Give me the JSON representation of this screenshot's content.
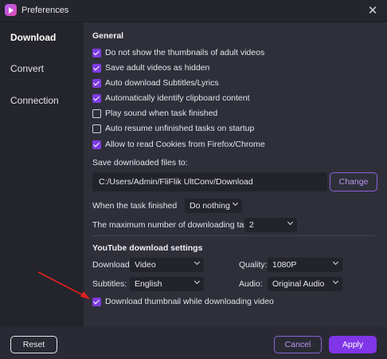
{
  "window": {
    "title": "Preferences"
  },
  "sidebar": {
    "items": [
      {
        "label": "Download",
        "active": true
      },
      {
        "label": "Convert",
        "active": false
      },
      {
        "label": "Connection",
        "active": false
      }
    ]
  },
  "general": {
    "title": "General",
    "options": [
      {
        "label": "Do not show the thumbnails of adult videos",
        "checked": true
      },
      {
        "label": "Save adult videos as hidden",
        "checked": true
      },
      {
        "label": "Auto download Subtitles/Lyrics",
        "checked": true
      },
      {
        "label": "Automatically identify clipboard content",
        "checked": true
      },
      {
        "label": "Play sound when task finished",
        "checked": false
      },
      {
        "label": "Auto resume unfinished tasks on startup",
        "checked": false
      },
      {
        "label": "Allow to read Cookies from Firefox/Chrome",
        "checked": true
      }
    ],
    "save_label": "Save downloaded files to:",
    "save_path": "C:/Users/Admin/FliFlik UltConv/Download",
    "change_label": "Change",
    "task_finished_label": "When the task finished",
    "task_finished_value": "Do nothing",
    "max_tasks_label": "The maximum number of downloading tasks:",
    "max_tasks_value": "2"
  },
  "youtube": {
    "title": "YouTube download settings",
    "download_label": "Download:",
    "download_value": "Video",
    "quality_label": "Quality:",
    "quality_value": "1080P",
    "subtitles_label": "Subtitles:",
    "subtitles_value": "English",
    "audio_label": "Audio:",
    "audio_value": "Original Audio",
    "thumbnail_label": "Download thumbnail while downloading video",
    "thumbnail_checked": true
  },
  "footer": {
    "reset_label": "Reset",
    "cancel_label": "Cancel",
    "apply_label": "Apply"
  },
  "colors": {
    "accent": "#8035e8",
    "annotation": "#e02020"
  }
}
